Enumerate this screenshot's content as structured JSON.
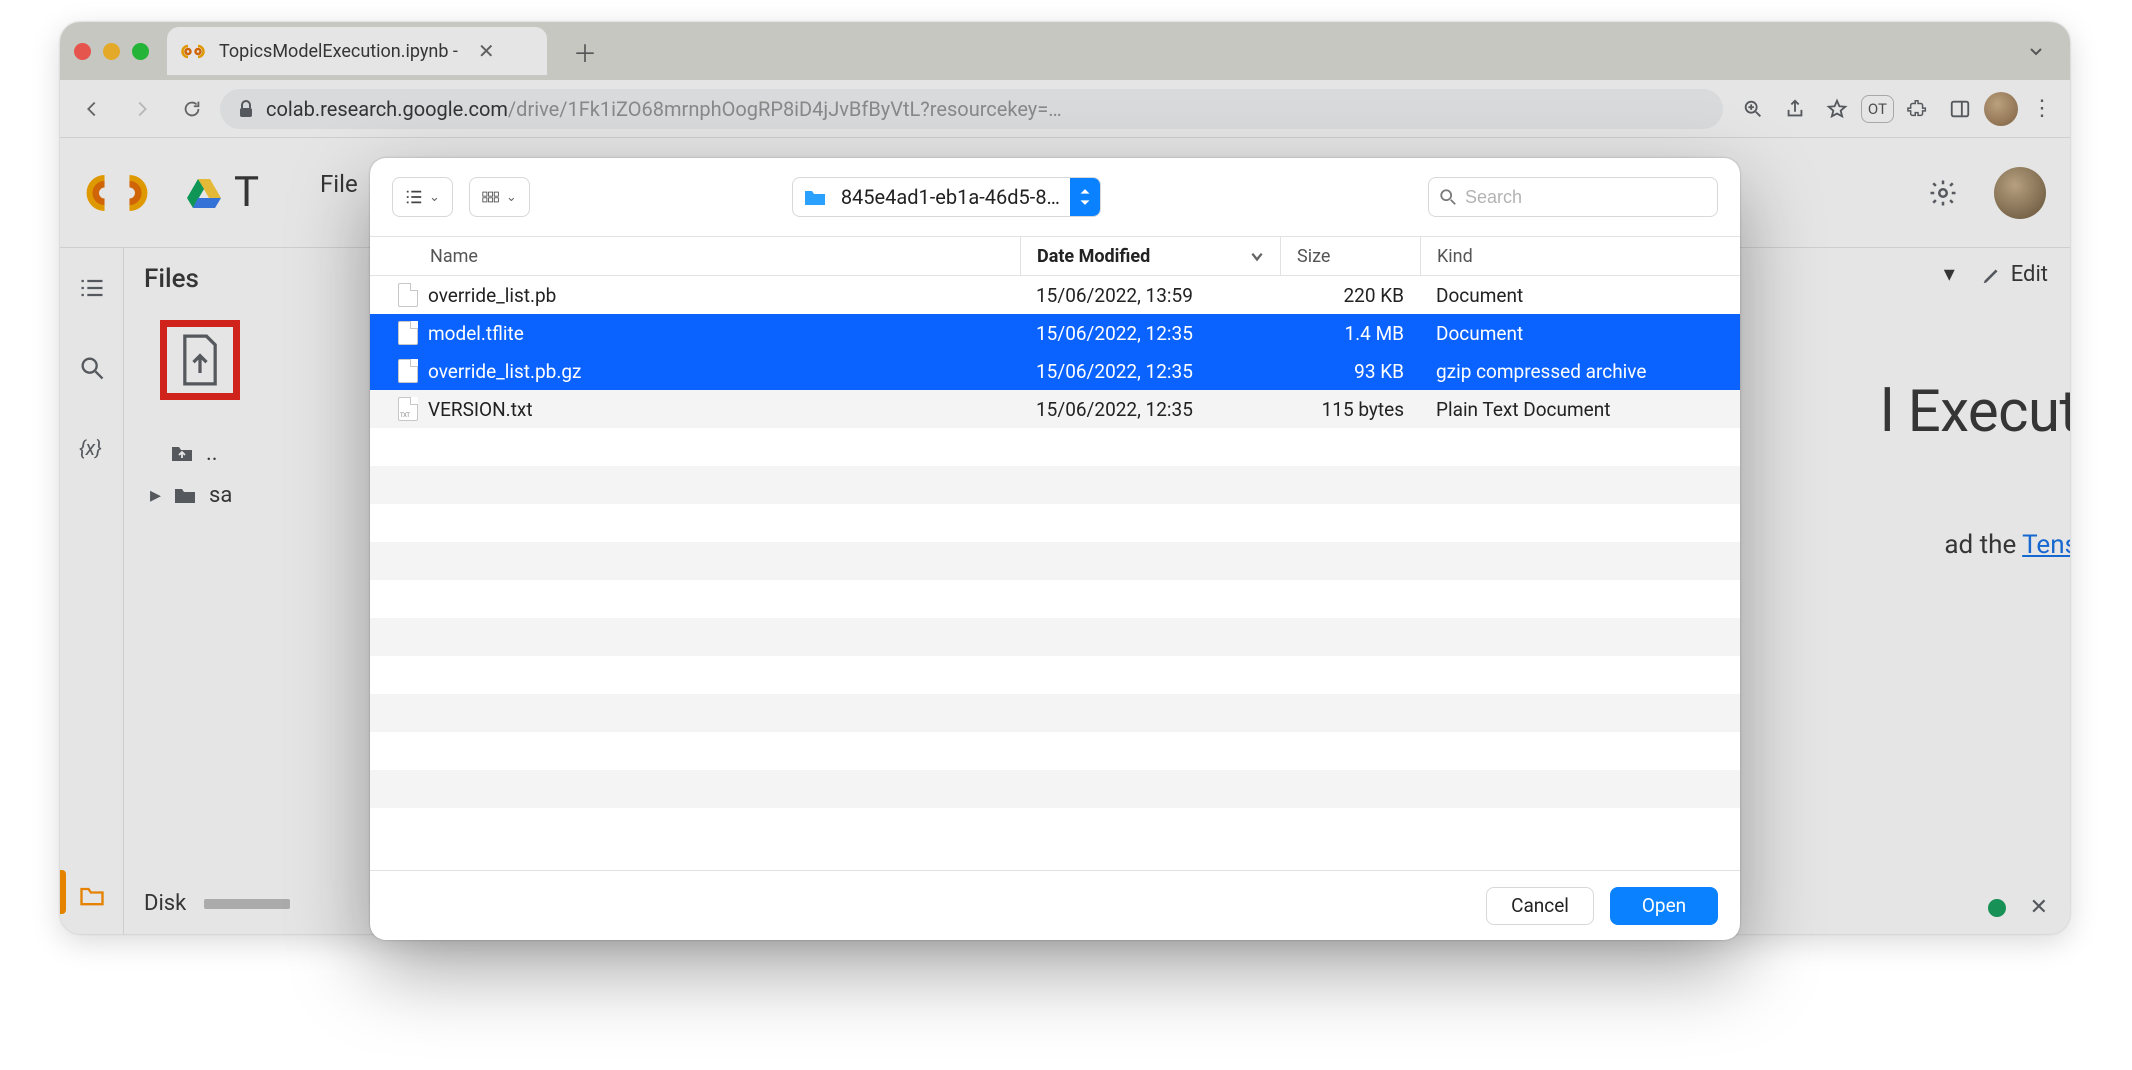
{
  "browser": {
    "tab_title": "TopicsModelExecution.ipynb -",
    "url_host": "colab.research.google.com",
    "url_path": "/drive/1Fk1iZO68mrnphOogRP8iD4jJvBfByVtL?resourcekey=…",
    "profile_chip": "OT"
  },
  "colab": {
    "doc_initial": "T",
    "menu_file": "File",
    "files_heading": "Files",
    "file_tree": {
      "up_label": "..",
      "sample_label": "sa"
    },
    "disk_label": "Disk",
    "toolbar_caret": "▾",
    "edit_label": "Edit",
    "big_title": "l Execut",
    "body_prefix": "ad the ",
    "body_link": "Tens",
    "close_x": "✕"
  },
  "dialog": {
    "folder_name": "845e4ad1-eb1a-46d5-8…",
    "search_placeholder": "Search",
    "columns": {
      "name": "Name",
      "date": "Date Modified",
      "size": "Size",
      "kind": "Kind"
    },
    "rows": [
      {
        "name": "override_list.pb",
        "date": "15/06/2022, 13:59",
        "size": "220 KB",
        "kind": "Document",
        "selected": false,
        "ico": "doc"
      },
      {
        "name": "model.tflite",
        "date": "15/06/2022, 12:35",
        "size": "1.4 MB",
        "kind": "Document",
        "selected": true,
        "ico": "doc"
      },
      {
        "name": "override_list.pb.gz",
        "date": "15/06/2022, 12:35",
        "size": "93 KB",
        "kind": "gzip compressed archive",
        "selected": true,
        "ico": "doc"
      },
      {
        "name": "VERSION.txt",
        "date": "15/06/2022, 12:35",
        "size": "115 bytes",
        "kind": "Plain Text Document",
        "selected": false,
        "ico": "txt"
      }
    ],
    "cancel_label": "Cancel",
    "open_label": "Open"
  }
}
